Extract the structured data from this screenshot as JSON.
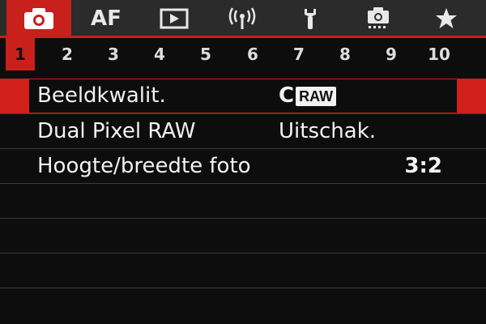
{
  "tabs": [
    {
      "icon": "camera-icon",
      "label": ""
    },
    {
      "icon": "af-tab",
      "label": "AF"
    },
    {
      "icon": "playback-icon",
      "label": ""
    },
    {
      "icon": "wireless-icon",
      "label": ""
    },
    {
      "icon": "wrench-icon",
      "label": ""
    },
    {
      "icon": "custom-camera-icon",
      "label": ""
    },
    {
      "icon": "star-icon",
      "label": ""
    }
  ],
  "pages": [
    "1",
    "2",
    "3",
    "4",
    "5",
    "6",
    "7",
    "8",
    "9",
    "10"
  ],
  "menu": {
    "items": [
      {
        "label": "Beeldkwalit.",
        "value_prefix": "C",
        "value_badge": "RAW"
      },
      {
        "label": "Dual Pixel RAW",
        "value": "Uitschak."
      },
      {
        "label": "Hoogte/breedte foto",
        "value": "3:2"
      }
    ]
  },
  "colors": {
    "accent": "#c8201b",
    "background": "#0d0d0d",
    "tabbar": "#2b2b2b"
  }
}
